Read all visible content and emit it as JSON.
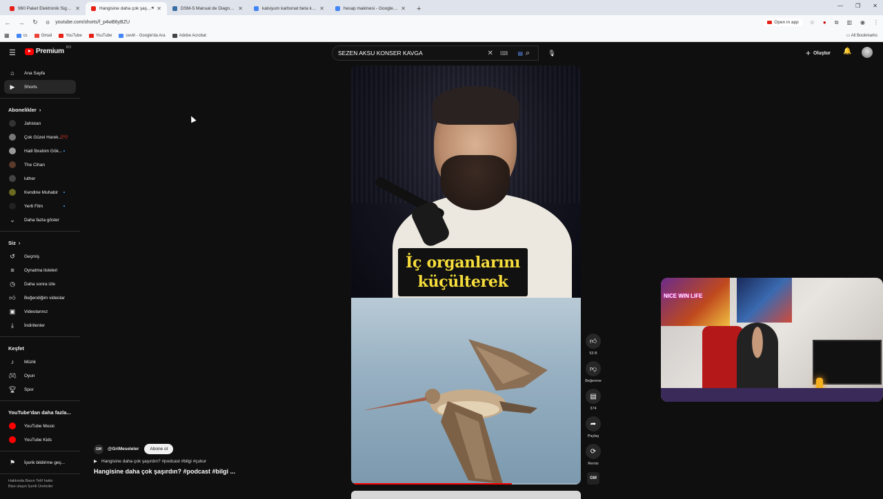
{
  "browser": {
    "tabs": [
      {
        "label": "960 Paket Elektronik Sigara Tü",
        "color": "#e62117"
      },
      {
        "label": "Hangisine daha çok şaşırdı",
        "color": "#e62117",
        "active": true
      },
      {
        "label": "DSM-5 Manual de Diagnostic",
        "color": "#3a6ea5"
      },
      {
        "label": "kalsiyum karbonat beta karote",
        "color": "#4285f4"
      },
      {
        "label": "hesap makinesi - Google'da Ara",
        "color": "#4285f4"
      }
    ],
    "url": "youtube.com/shorts/f_p4wB6yBZU",
    "open_in_app": "Open in app",
    "bookmarks": [
      {
        "label": "cs",
        "color": "#4285f4"
      },
      {
        "label": "Gmail",
        "color": "#ea4335"
      },
      {
        "label": "YouTube",
        "color": "#e62117"
      },
      {
        "label": "YouTube",
        "color": "#e62117"
      },
      {
        "label": "ceviri - Google'da Ara",
        "color": "#4285f4"
      },
      {
        "label": "Adobe Acrobat",
        "color": "#444444"
      }
    ],
    "all_bookmarks": "All Bookmarks"
  },
  "youtube": {
    "logo_text": "Premium",
    "logo_country": "RO",
    "search_query": "SEZEN AKSU KONSER KAVGA",
    "create_label": "Oluştur",
    "sidebar": {
      "main": [
        {
          "label": "Ana Sayfa",
          "icon": "home-icon"
        },
        {
          "label": "Shorts",
          "icon": "shorts-icon",
          "active": true
        }
      ],
      "subs_header": "Abonelikler",
      "subs": [
        {
          "label": "Jahistan",
          "color": "#333333"
        },
        {
          "label": "Çok Güzel Harek...",
          "color": "#777777",
          "live": true
        },
        {
          "label": "Halil İbrahim Gök...",
          "color": "#999999",
          "new": true
        },
        {
          "label": "The Cihan",
          "color": "#5a3a2a"
        },
        {
          "label": "luther",
          "color": "#444444"
        },
        {
          "label": "Kendine Muhabir",
          "color": "#6a6a20",
          "new": true
        },
        {
          "label": "Yer6 Film",
          "color": "#222222",
          "new": true
        },
        {
          "label": "Daha fazla göster",
          "icon": "chevron-down-icon"
        }
      ],
      "you_header": "Siz",
      "you": [
        {
          "label": "Geçmiş",
          "icon": "history-icon"
        },
        {
          "label": "Oynatma listeleri",
          "icon": "playlist-icon"
        },
        {
          "label": "Daha sonra izle",
          "icon": "clock-icon"
        },
        {
          "label": "Beğendiğim videolar",
          "icon": "like-icon"
        },
        {
          "label": "Videolarınız",
          "icon": "video-icon"
        },
        {
          "label": "İndirilenler",
          "icon": "download-icon"
        }
      ],
      "explore_header": "Keşfet",
      "explore": [
        {
          "label": "Müzik",
          "icon": "music-icon"
        },
        {
          "label": "Oyun",
          "icon": "gaming-icon"
        },
        {
          "label": "Spor",
          "icon": "trophy-icon"
        }
      ],
      "more_header": "YouTube'dan daha fazla...",
      "more": [
        {
          "label": "YouTube Music",
          "color": "#ff0000"
        },
        {
          "label": "YouTube Kids",
          "color": "#ff0000"
        }
      ],
      "report": "İçerik bildirime geç...",
      "footer1": "Hakkında  Basın  Telif hakkı",
      "footer2": "Bize ulaşın  İçerik Üreticiler"
    },
    "short": {
      "caption_line1": "İç organlarını",
      "caption_line2": "küçülterek",
      "progress": 0.7,
      "like_count": "53 B",
      "dislike_label": "Beğenme",
      "comment_count": "374",
      "share_label": "Paylaş",
      "remix_label": "Remix",
      "channel_avatar_text": "GM",
      "channel": "@GriMeseleler",
      "subscribe_label": "Abone ol",
      "music_text": "Hangisine daha çok şaşırdın? #podcast #bilgi #çukur",
      "title": "Hangisine daha çok şaşırdın? #podcast #bilgi ..."
    },
    "webcam_sign": "NICE WIN LIFE"
  }
}
